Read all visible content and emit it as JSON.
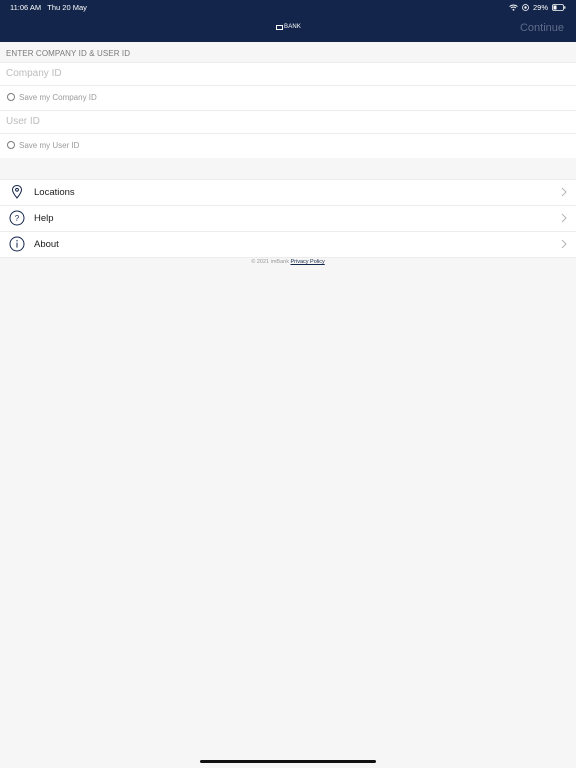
{
  "status_bar": {
    "time": "11:06 AM",
    "date": "Thu 20 May",
    "battery": "29%"
  },
  "header": {
    "logo_text": "BANK",
    "continue_label": "Continue"
  },
  "login": {
    "section_title": "ENTER COMPANY ID & USER ID",
    "company_id_placeholder": "Company ID",
    "save_company_label": "Save my Company ID",
    "user_id_placeholder": "User ID",
    "save_user_label": "Save my User ID"
  },
  "menu": {
    "items": [
      {
        "label": "Locations",
        "icon": "location-pin-icon"
      },
      {
        "label": "Help",
        "icon": "question-circle-icon"
      },
      {
        "label": "About",
        "icon": "info-circle-icon"
      }
    ]
  },
  "footer": {
    "copyright": "© 2021 imBank",
    "privacy_link": "Privacy Policy"
  },
  "colors": {
    "header_bg": "#13254a",
    "accent": "#13254a"
  }
}
